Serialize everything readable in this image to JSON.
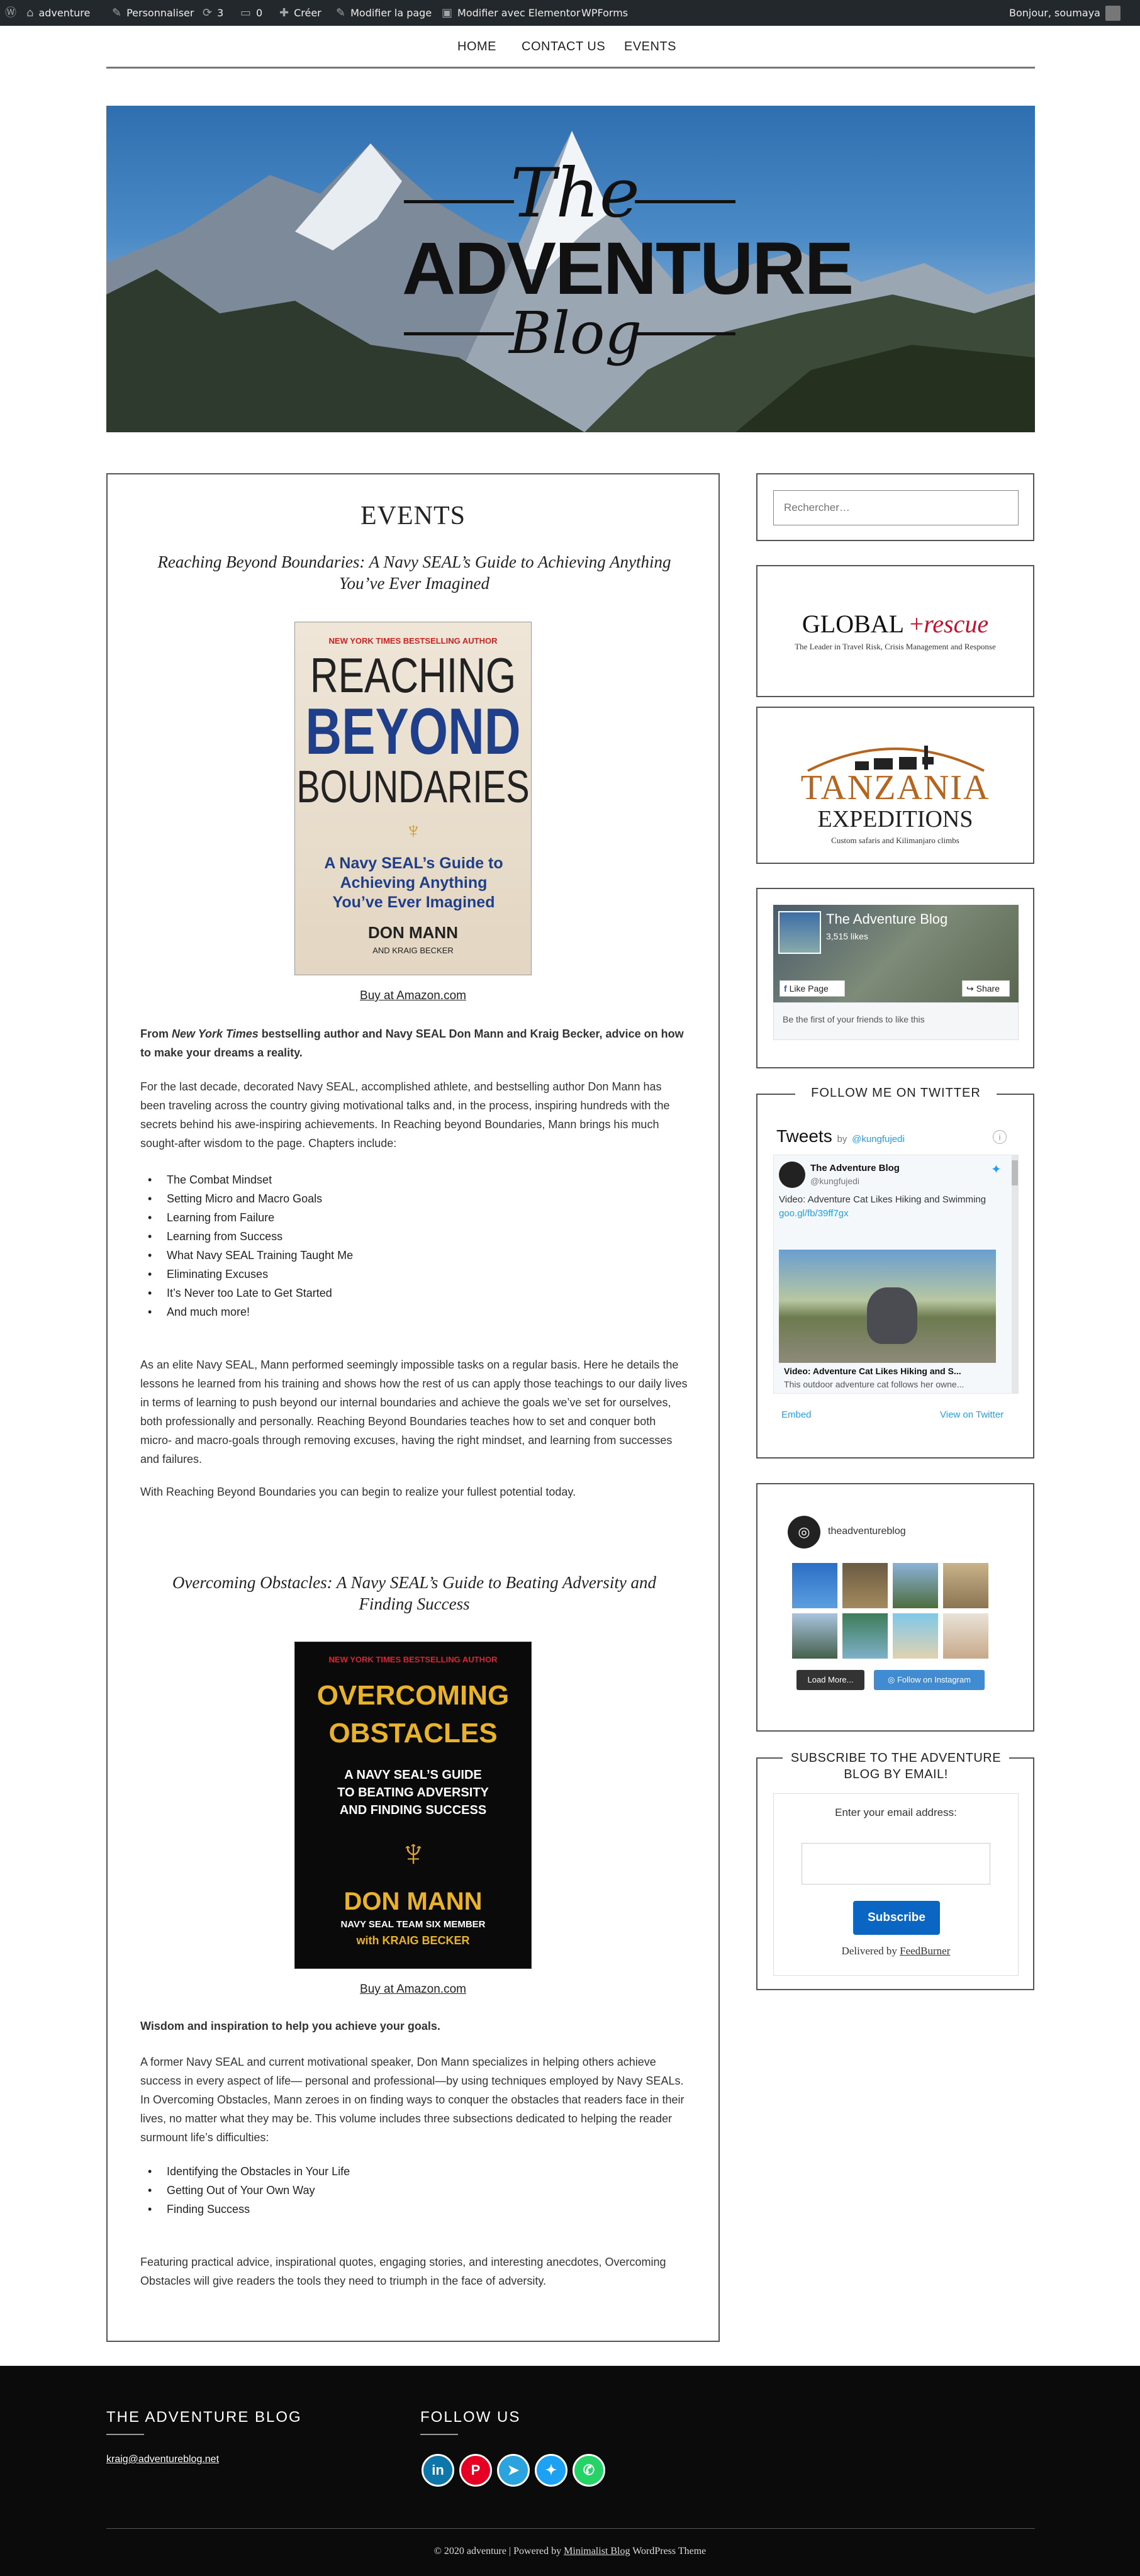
{
  "adminbar": {
    "site": "adventure",
    "customize": "Personnaliser",
    "updates": "3",
    "comments": "0",
    "new": "Créer",
    "edit": "Modifier la page",
    "elementor": "Modifier avec Elementor",
    "wpforms": "WPForms",
    "greeting": "Bonjour, soumaya"
  },
  "nav": {
    "home": "HOME",
    "contact": "CONTACT US",
    "events": "EVENTS"
  },
  "hero": {
    "the": "The",
    "adventure": "ADVENTURE",
    "blog": "Blog"
  },
  "page": {
    "title": "EVENTS"
  },
  "book1": {
    "title": "Reaching Beyond Boundaries: A Navy SEAL’s Guide to Achieving Anything You’ve Ever Imagined",
    "cover_top": "NEW YORK TIMES BESTSELLING AUTHOR",
    "cover_l1": "REACHING",
    "cover_l2": "BEYOND",
    "cover_l3": "BOUNDARIES",
    "cover_sub": "A Navy SEAL’s Guide to Achieving Anything You’ve Ever Imagined",
    "cover_author": "DON MANN",
    "cover_co": "AND KRAIG BECKER",
    "buy": "Buy at Amazon.com",
    "intro_a": "From ",
    "intro_em": "New York Times",
    "intro_b": " bestselling author and Navy SEAL Don Mann and Kraig Becker, advice on how to make your dreams a reality.",
    "p1": "For the last decade, decorated Navy SEAL, accomplished athlete, and bestselling author Don Mann has been traveling across the country giving motivational talks and, in the process, inspiring hundreds with the secrets behind his awe-inspiring achievements. In Reaching beyond Boundaries, Mann brings his much sought-after wisdom to the page. Chapters include:",
    "list": [
      "The Combat Mindset",
      "Setting Micro and Macro Goals",
      "Learning from Failure",
      "Learning from Success",
      "What Navy SEAL Training Taught Me",
      "Eliminating Excuses",
      "It’s Never too Late to Get Started",
      "And much more!"
    ],
    "p2": "As an elite Navy SEAL, Mann performed seemingly impossible tasks on a regular basis. Here he details the lessons he learned from his training and shows how the rest of us can apply those teachings to our daily lives in terms of learning to push beyond our internal boundaries and achieve the goals we’ve set for ourselves, both professionally and personally. Reaching Beyond Boundaries teaches how to set and conquer both micro- and macro-goals through removing excuses, having the right mindset, and learning from successes and failures.",
    "p3": "With Reaching Beyond Boundaries you can begin to realize your fullest potential today."
  },
  "book2": {
    "title": "Overcoming Obstacles: A Navy SEAL’s Guide to Beating Adversity and Finding Success",
    "cover_top": "NEW YORK TIMES BESTSELLING AUTHOR",
    "cover_l1": "OVERCOMING",
    "cover_l2": "OBSTACLES",
    "cover_sub1": "A NAVY SEAL’S GUIDE",
    "cover_sub2": "TO BEATING ADVERSITY",
    "cover_sub3": "AND FINDING SUCCESS",
    "cover_author": "DON MANN",
    "cover_co": "NAVY SEAL TEAM SIX MEMBER",
    "cover_co2": "with KRAIG BECKER",
    "buy": "Buy at Amazon.com",
    "intro": "Wisdom and inspiration to help you achieve your goals.",
    "p1": "A former Navy SEAL and current motivational speaker, Don Mann specializes in helping others achieve success in every aspect of life— personal and professional—by using techniques employed by Navy SEALs. In Overcoming Obstacles, Mann zeroes in on finding ways to conquer the obstacles that readers face in their lives, no matter what they may be. This volume includes three subsections dedicated to helping the reader surmount life’s difficulties:",
    "list": [
      "Identifying the Obstacles in Your Life",
      "Getting Out of Your Own Way",
      "Finding Success"
    ],
    "p2": "Featuring practical advice, inspirational quotes, engaging stories, and interesting anecdotes, Overcoming Obstacles will give readers the tools they need to triumph in the face of adversity."
  },
  "sidebar": {
    "search_placeholder": "Rechercher…",
    "global_a": "GLOBAL",
    "global_b": "rescue",
    "global_tag": "The Leader in Travel Risk, Crisis Management and Response",
    "tz_a": "TANZANIA",
    "tz_b": "EXPEDITIONS",
    "tz_tag": "Custom safaris and Kilimanjaro climbs",
    "fb": {
      "name": "The Adventure Blog",
      "likes": "3,515 likes",
      "like_btn": "Like Page",
      "share_btn": "Share",
      "friends": "Be the first of your friends to like this"
    },
    "twitter": {
      "heading": "FOLLOW ME ON TWITTER",
      "tweets": "Tweets",
      "by": "by",
      "handle_link": "@kungfujedi",
      "user": "The Adventure Blog",
      "user_handle": "@kungfujedi",
      "text": "Video: Adventure Cat Likes Hiking and Swimming",
      "link": "goo.gl/fb/39ff7gx",
      "card_title": "Video: Adventure Cat Likes Hiking and S...",
      "card_desc": "This outdoor adventure cat follows her owne...",
      "embed": "Embed",
      "view": "View on Twitter"
    },
    "insta": {
      "user": "theadventureblog",
      "load": "Load More...",
      "follow": "Follow on Instagram"
    },
    "subscribe": {
      "heading": "SUBSCRIBE TO THE ADVENTURE BLOG BY EMAIL!",
      "label": "Enter your email address:",
      "button": "Subscribe",
      "delivered": "Delivered by",
      "feedburner": "FeedBurner"
    }
  },
  "footer": {
    "col1": "THE ADVENTURE BLOG",
    "email": "kraig@adventureblog.net",
    "col2": "FOLLOW US",
    "copy_a": "© 2020 adventure | Powered by ",
    "copy_link": "Minimalist Blog",
    "copy_b": " WordPress Theme"
  },
  "colors": {
    "adminbar": "#23282d",
    "footer": "#0b0b0b",
    "subscribe": "#0b66c3",
    "linkedin": "#0e76a8",
    "pinterest": "#e60023",
    "telegram": "#2aa3df",
    "twitter": "#1da1f2",
    "whatsapp": "#25d366"
  }
}
